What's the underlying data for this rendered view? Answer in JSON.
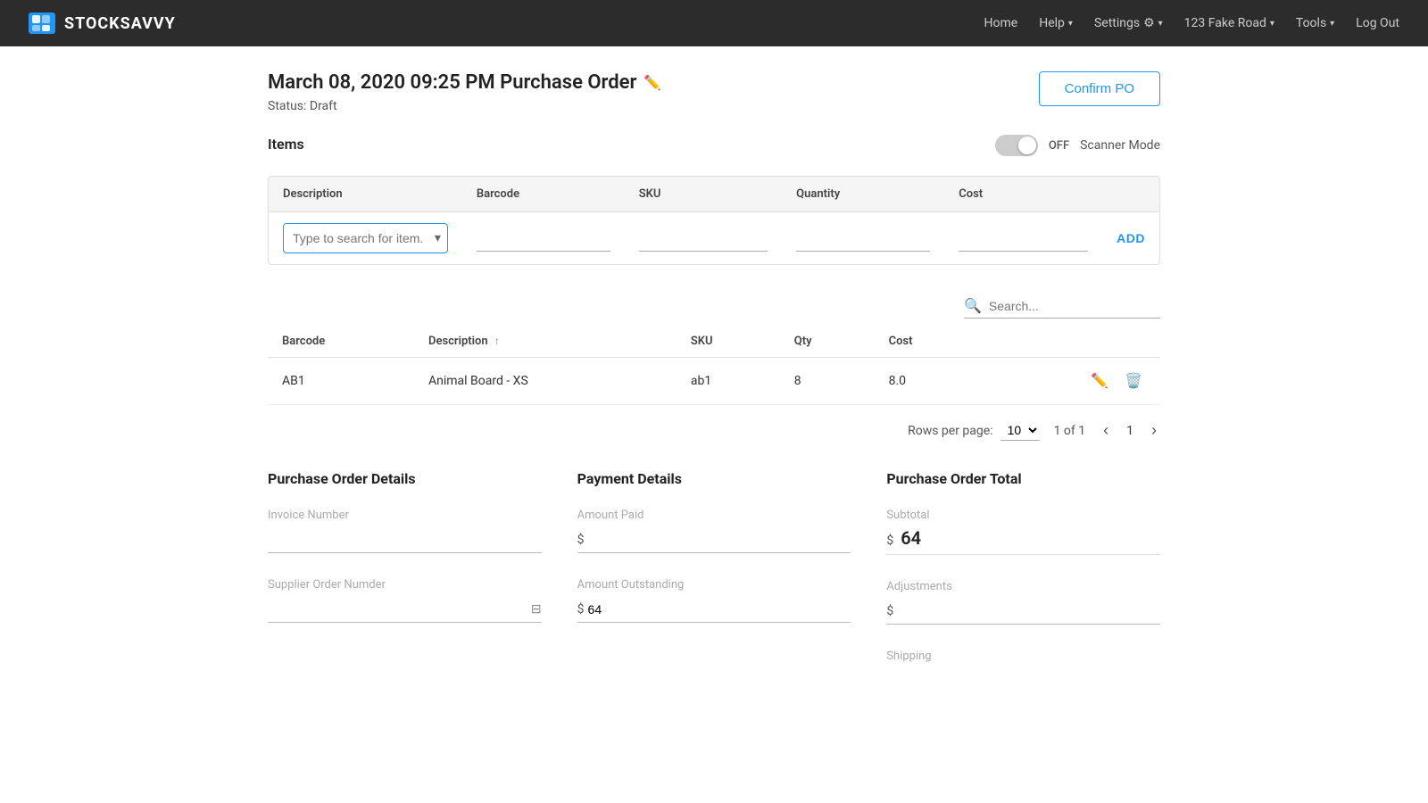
{
  "navbar": {
    "brand": "STOCKSAVVY",
    "nav_items": [
      {
        "label": "Home",
        "dropdown": false
      },
      {
        "label": "Help",
        "dropdown": true
      },
      {
        "label": "Settings",
        "dropdown": true,
        "icon": "gear"
      },
      {
        "label": "123 Fake Road",
        "dropdown": true
      },
      {
        "label": "Tools",
        "dropdown": true
      },
      {
        "label": "Log Out",
        "dropdown": false
      }
    ]
  },
  "page": {
    "title": "March 08, 2020 09:25 PM Purchase Order",
    "status": "Status: Draft",
    "confirm_po_label": "Confirm PO"
  },
  "items_section": {
    "label": "Items",
    "scanner_mode_label": "Scanner Mode",
    "toggle_state": "OFF"
  },
  "add_row": {
    "description_placeholder": "Type to search for item..",
    "add_button_label": "ADD"
  },
  "table_headers": {
    "barcode": "Barcode",
    "description": "Description",
    "sku": "SKU",
    "qty": "Qty",
    "cost": "Cost"
  },
  "table_rows": [
    {
      "barcode": "AB1",
      "description": "Animal Board - XS",
      "sku": "ab1",
      "qty": "8",
      "cost": "8.0"
    }
  ],
  "search": {
    "placeholder": "Search..."
  },
  "pagination": {
    "rows_per_page_label": "Rows per page:",
    "rows_per_page_value": "10",
    "page_info": "1 of 1",
    "current_page": "1"
  },
  "purchase_order_details": {
    "title": "Purchase Order Details",
    "invoice_number_label": "Invoice Number",
    "invoice_number_value": "",
    "supplier_order_label": "Supplier Order Numder",
    "supplier_order_value": ""
  },
  "payment_details": {
    "title": "Payment Details",
    "amount_paid_label": "Amount Paid",
    "amount_paid_prefix": "$",
    "amount_paid_value": "",
    "amount_outstanding_label": "Amount Outstanding",
    "amount_outstanding_prefix": "$",
    "amount_outstanding_value": "64"
  },
  "purchase_order_total": {
    "title": "Purchase Order Total",
    "subtotal_label": "Subtotal",
    "subtotal_prefix": "$",
    "subtotal_value": "64",
    "adjustments_label": "Adjustments",
    "adjustments_prefix": "$",
    "adjustments_value": "",
    "shipping_label": "Shipping"
  }
}
